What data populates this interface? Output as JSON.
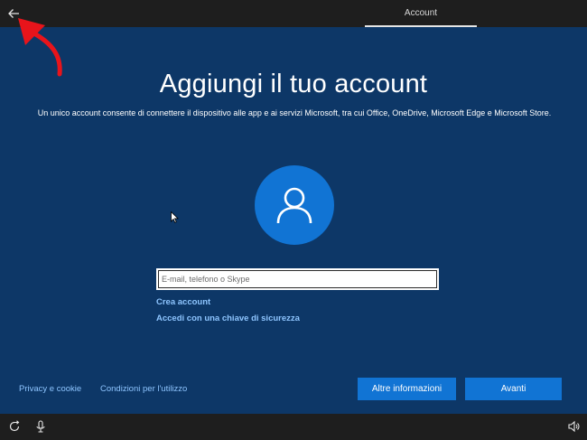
{
  "header": {
    "tab_label": "Account",
    "back_icon": "back-arrow-icon"
  },
  "main": {
    "title": "Aggiungi il tuo account",
    "subtitle": "Un unico account consente di connettere il dispositivo alle app e ai servizi Microsoft, tra cui Office, OneDrive, Microsoft Edge e Microsoft Store.",
    "avatar_icon": "user-icon",
    "email_input": {
      "value": "",
      "placeholder": "E-mail, telefono o Skype"
    },
    "links": {
      "create_account": "Crea account",
      "security_key": "Accedi con una chiave di sicurezza"
    }
  },
  "footer": {
    "privacy": "Privacy e cookie",
    "terms": "Condizioni per l'utilizzo",
    "more_info": "Altre informazioni",
    "next": "Avanti"
  },
  "taskbar": {
    "icons": [
      "ease-of-access-icon",
      "microphone-icon",
      "volume-icon"
    ]
  },
  "colors": {
    "background": "#0d3767",
    "accent": "#1174d4",
    "link": "#8ec5ff",
    "bar": "#1e1e1e",
    "annotation": "#e8141b"
  }
}
